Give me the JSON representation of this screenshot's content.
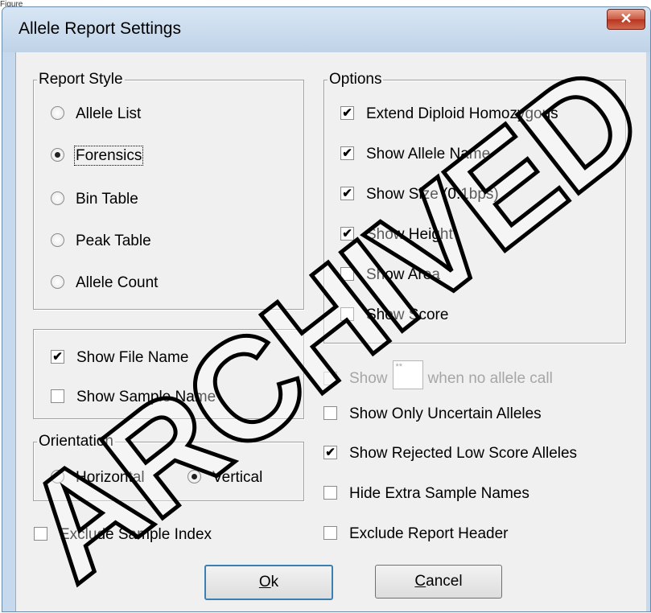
{
  "caption": "Figure",
  "window": {
    "title": "Allele Report Settings",
    "close_glyph": "✕"
  },
  "report_style": {
    "legend": "Report Style",
    "options": [
      {
        "label": "Allele List",
        "selected": false
      },
      {
        "label": "Forensics",
        "selected": true
      },
      {
        "label": "Bin Table",
        "selected": false
      },
      {
        "label": "Peak Table",
        "selected": false
      },
      {
        "label": "Allele Count",
        "selected": false
      }
    ]
  },
  "options": {
    "legend": "Options",
    "items": [
      {
        "label": "Extend Diploid Homozygous",
        "checked": true
      },
      {
        "label": "Show Allele Name",
        "checked": true
      },
      {
        "label": "Show Size (0.1bps)",
        "checked": true
      },
      {
        "label": "Show Height",
        "checked": true
      },
      {
        "label": "Show Area",
        "checked": false
      },
      {
        "label": "Show Score",
        "checked": false
      }
    ]
  },
  "names": {
    "show_file_name": {
      "label": "Show File Name",
      "checked": true
    },
    "show_sample_name": {
      "label": "Show Sample Name",
      "checked": false
    }
  },
  "orientation": {
    "legend": "Orientation",
    "horizontal": {
      "label": "Horizontal",
      "selected": false
    },
    "vertical": {
      "label": "Vertical",
      "selected": true
    }
  },
  "exclude_sample_index": {
    "label": "Exclude Sample Index",
    "checked": false
  },
  "no_call": {
    "label_before": "Show",
    "input_value": "**",
    "label_after": "when no allele call",
    "checked": false,
    "disabled": true
  },
  "right_checks": [
    {
      "label": "Show Only Uncertain Alleles",
      "checked": false
    },
    {
      "label": "Show Rejected Low Score Alleles",
      "checked": true
    },
    {
      "label": "Hide Extra Sample Names",
      "checked": false
    },
    {
      "label": "Exclude Report Header",
      "checked": false
    }
  ],
  "buttons": {
    "ok": {
      "mnemonic": "O",
      "rest": "k"
    },
    "cancel": {
      "mnemonic": "C",
      "rest": "ancel"
    }
  },
  "check_glyph": "✔",
  "watermark": "ARCHIVED"
}
